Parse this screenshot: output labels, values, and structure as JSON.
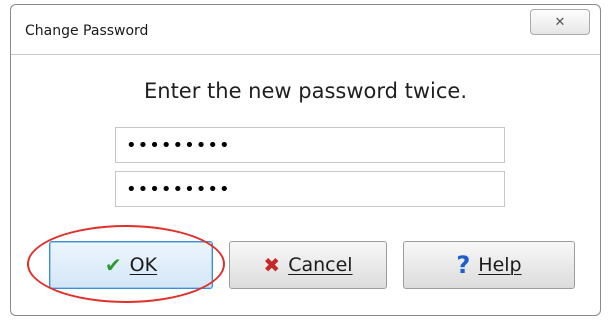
{
  "window": {
    "title": "Change Password",
    "close_glyph": "✕"
  },
  "prompt": "Enter the new password twice.",
  "fields": {
    "password_new": "•••••••••",
    "password_confirm": "•••••••••"
  },
  "buttons": {
    "ok": {
      "label": "OK",
      "icon": "check-icon"
    },
    "cancel": {
      "label": "Cancel",
      "icon": "x-icon"
    },
    "help": {
      "label": "Help",
      "icon": "question-icon"
    }
  },
  "colors": {
    "highlight": "#e0302b",
    "check": "#2f9a2f",
    "cancel_x": "#c62828",
    "help_q": "#1d5fc9"
  }
}
